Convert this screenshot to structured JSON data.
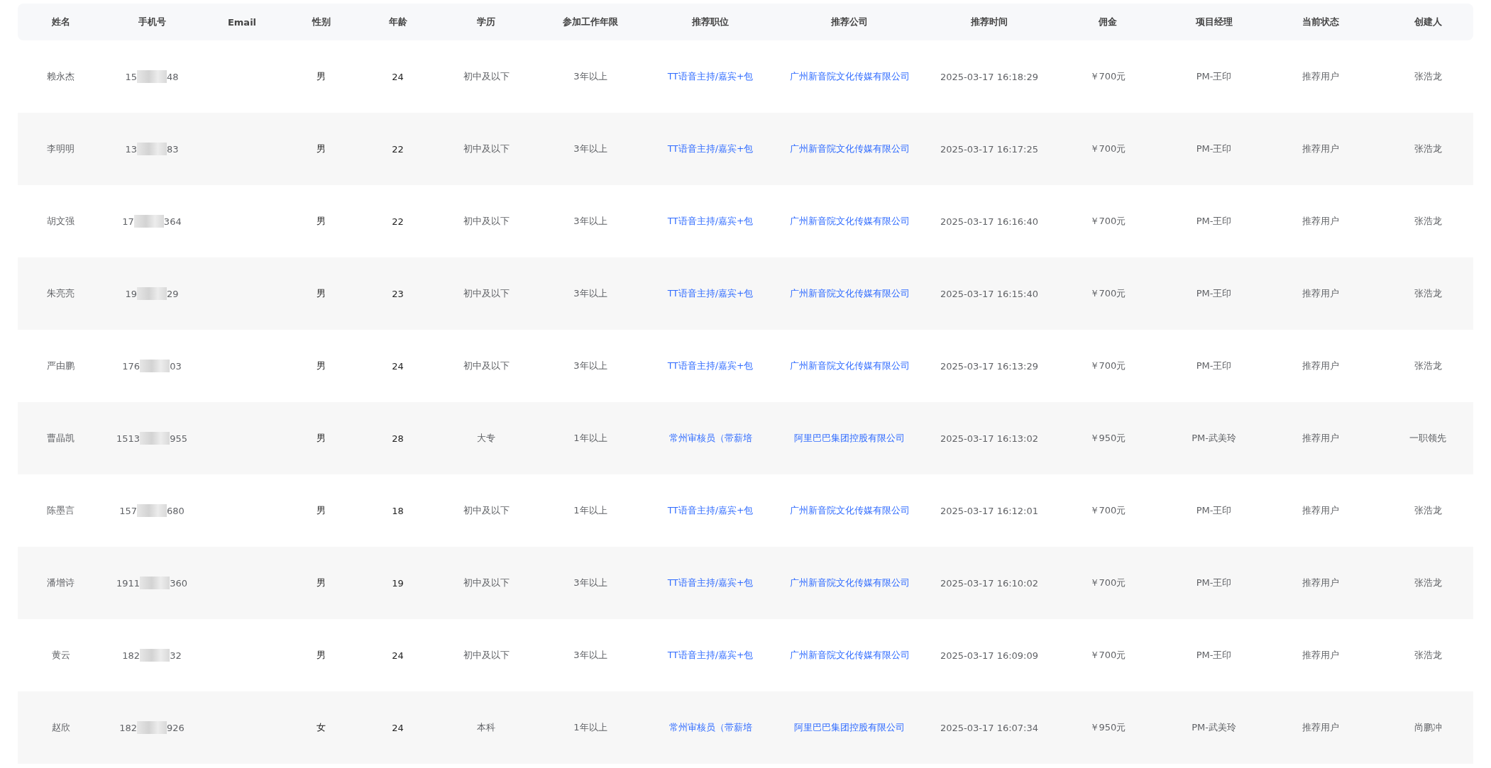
{
  "table": {
    "columns": [
      "姓名",
      "手机号",
      "Email",
      "性别",
      "年龄",
      "学历",
      "参加工作年限",
      "推荐职位",
      "推荐公司",
      "推荐时间",
      "佣金",
      "项目经理",
      "当前状态",
      "创建人"
    ],
    "rows": [
      {
        "name": "赖永杰",
        "phone_start": "15",
        "phone_end": "48",
        "gender": "男",
        "age": "24",
        "education": "初中及以下",
        "experience": "3年以上",
        "position": "TT语音主持/嘉宾+包",
        "company": "广州新音院文化传媒有限公司",
        "time": "2025-03-17 16:18:29",
        "commission": "￥700元",
        "manager": "PM-王印",
        "status": "推荐用户",
        "creator": "张浩龙"
      },
      {
        "name": "李明明",
        "phone_start": "13",
        "phone_end": "83",
        "gender": "男",
        "age": "22",
        "education": "初中及以下",
        "experience": "3年以上",
        "position": "TT语音主持/嘉宾+包",
        "company": "广州新音院文化传媒有限公司",
        "time": "2025-03-17 16:17:25",
        "commission": "￥700元",
        "manager": "PM-王印",
        "status": "推荐用户",
        "creator": "张浩龙"
      },
      {
        "name": "胡文强",
        "phone_start": "17",
        "phone_end": "364",
        "gender": "男",
        "age": "22",
        "education": "初中及以下",
        "experience": "3年以上",
        "position": "TT语音主持/嘉宾+包",
        "company": "广州新音院文化传媒有限公司",
        "time": "2025-03-17 16:16:40",
        "commission": "￥700元",
        "manager": "PM-王印",
        "status": "推荐用户",
        "creator": "张浩龙"
      },
      {
        "name": "朱亮亮",
        "phone_start": "19",
        "phone_end": "29",
        "gender": "男",
        "age": "23",
        "education": "初中及以下",
        "experience": "3年以上",
        "position": "TT语音主持/嘉宾+包",
        "company": "广州新音院文化传媒有限公司",
        "time": "2025-03-17 16:15:40",
        "commission": "￥700元",
        "manager": "PM-王印",
        "status": "推荐用户",
        "creator": "张浩龙"
      },
      {
        "name": "严由鹏",
        "phone_start": "176",
        "phone_end": "03",
        "gender": "男",
        "age": "24",
        "education": "初中及以下",
        "experience": "3年以上",
        "position": "TT语音主持/嘉宾+包",
        "company": "广州新音院文化传媒有限公司",
        "time": "2025-03-17 16:13:29",
        "commission": "￥700元",
        "manager": "PM-王印",
        "status": "推荐用户",
        "creator": "张浩龙"
      },
      {
        "name": "曹晶凯",
        "phone_start": "1513",
        "phone_end": "955",
        "gender": "男",
        "age": "28",
        "education": "大专",
        "experience": "1年以上",
        "position": "常州审核员（带薪培",
        "company": "阿里巴巴集团控股有限公司",
        "time": "2025-03-17 16:13:02",
        "commission": "￥950元",
        "manager": "PM-武美玲",
        "status": "推荐用户",
        "creator": "一职领先"
      },
      {
        "name": "陈墨言",
        "phone_start": "157",
        "phone_end": "680",
        "gender": "男",
        "age": "18",
        "education": "初中及以下",
        "experience": "1年以上",
        "position": "TT语音主持/嘉宾+包",
        "company": "广州新音院文化传媒有限公司",
        "time": "2025-03-17 16:12:01",
        "commission": "￥700元",
        "manager": "PM-王印",
        "status": "推荐用户",
        "creator": "张浩龙"
      },
      {
        "name": "潘增诗",
        "phone_start": "1911",
        "phone_end": "360",
        "gender": "男",
        "age": "19",
        "education": "初中及以下",
        "experience": "3年以上",
        "position": "TT语音主持/嘉宾+包",
        "company": "广州新音院文化传媒有限公司",
        "time": "2025-03-17 16:10:02",
        "commission": "￥700元",
        "manager": "PM-王印",
        "status": "推荐用户",
        "creator": "张浩龙"
      },
      {
        "name": "黄云",
        "phone_start": "182",
        "phone_end": "32",
        "gender": "男",
        "age": "24",
        "education": "初中及以下",
        "experience": "3年以上",
        "position": "TT语音主持/嘉宾+包",
        "company": "广州新音院文化传媒有限公司",
        "time": "2025-03-17 16:09:09",
        "commission": "￥700元",
        "manager": "PM-王印",
        "status": "推荐用户",
        "creator": "张浩龙"
      },
      {
        "name": "赵欣",
        "phone_start": "182",
        "phone_end": "926",
        "gender": "女",
        "age": "24",
        "education": "本科",
        "experience": "1年以上",
        "position": "常州审核员（带薪培",
        "company": "阿里巴巴集团控股有限公司",
        "time": "2025-03-17 16:07:34",
        "commission": "￥950元",
        "manager": "PM-武美玲",
        "status": "推荐用户",
        "creator": "尚鹏冲"
      }
    ]
  }
}
